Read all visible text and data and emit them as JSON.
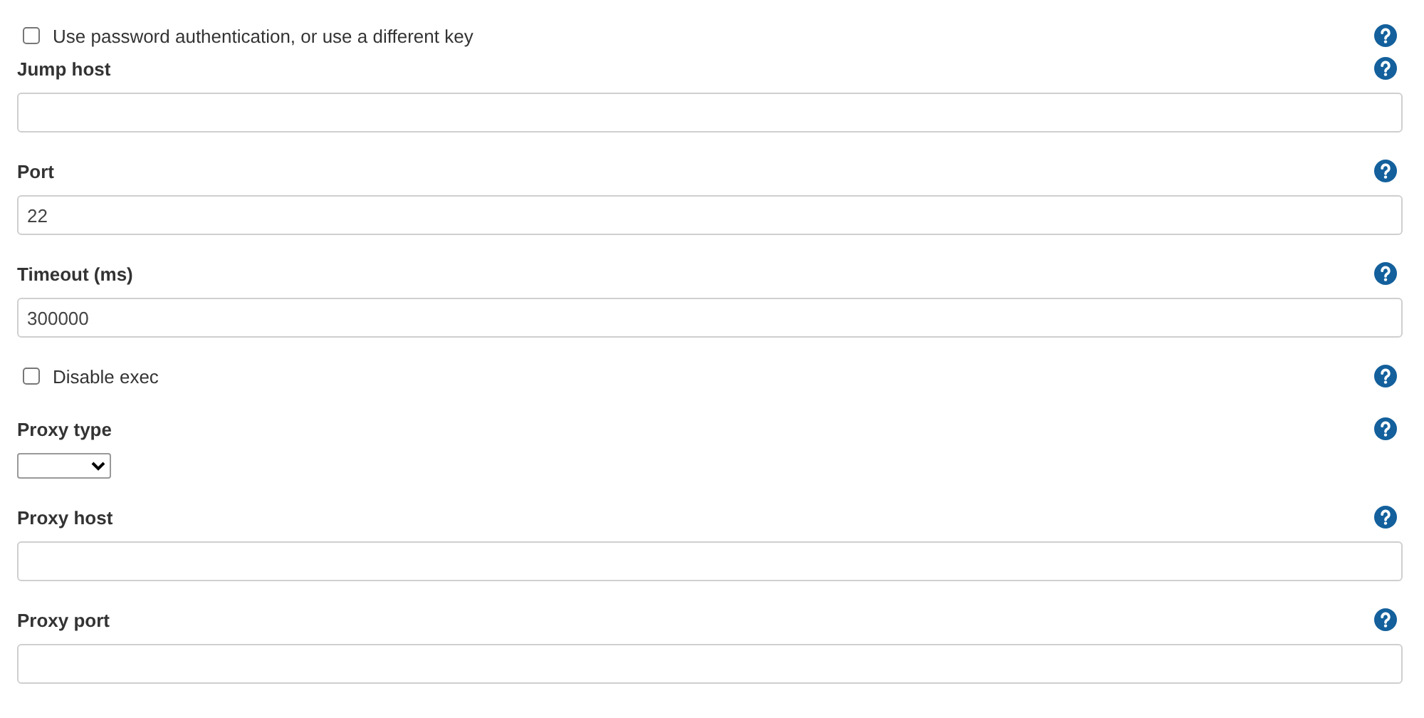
{
  "fields": [
    {
      "kind": "checkbox",
      "label": "Use password authentication, or use a different key",
      "checked": false
    },
    {
      "kind": "text",
      "label": "Jump host"
    },
    {
      "kind": "text",
      "label": "Port",
      "value": "22"
    },
    {
      "kind": "text",
      "label": "Timeout (ms)",
      "value": "300000"
    },
    {
      "kind": "checkbox",
      "label": "Disable exec",
      "checked": false
    },
    {
      "kind": "select",
      "label": "Proxy type"
    },
    {
      "kind": "text",
      "label": "Proxy host"
    },
    {
      "kind": "text",
      "label": "Proxy port"
    }
  ]
}
